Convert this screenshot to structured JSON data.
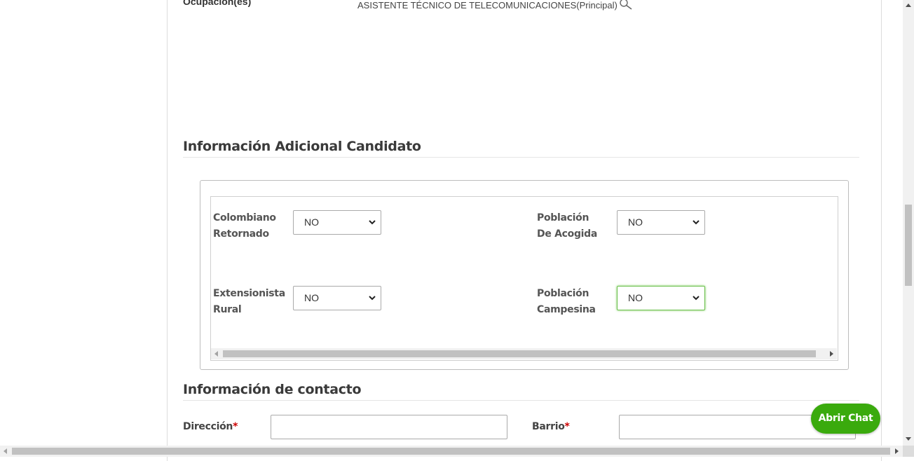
{
  "occupation": {
    "label": "Ocupación(es)",
    "value": "ASISTENTE TÉCNICO DE TELECOMUNICACIONES(Principal)",
    "icon": "search-icon"
  },
  "additional_info": {
    "title": "Información Adicional Candidato",
    "fields": [
      {
        "label_line1": "Colombiano",
        "label_line2": "Retornado",
        "selected": "NO"
      },
      {
        "label_line1": "Población",
        "label_line2": "De Acogida",
        "selected": "NO"
      },
      {
        "label_line1": "Extensionista",
        "label_line2": "Rural",
        "selected": "NO"
      },
      {
        "label_line1": "Población",
        "label_line2": "Campesina",
        "selected": "NO"
      }
    ]
  },
  "contact": {
    "title": "Información de contacto",
    "address_label": "Dirección",
    "neighborhood_label": "Barrio",
    "required_mark": "*",
    "address_value": "",
    "neighborhood_value": ""
  },
  "chat": {
    "label": "Abrir Chat",
    "color": "#3aaa0d"
  }
}
